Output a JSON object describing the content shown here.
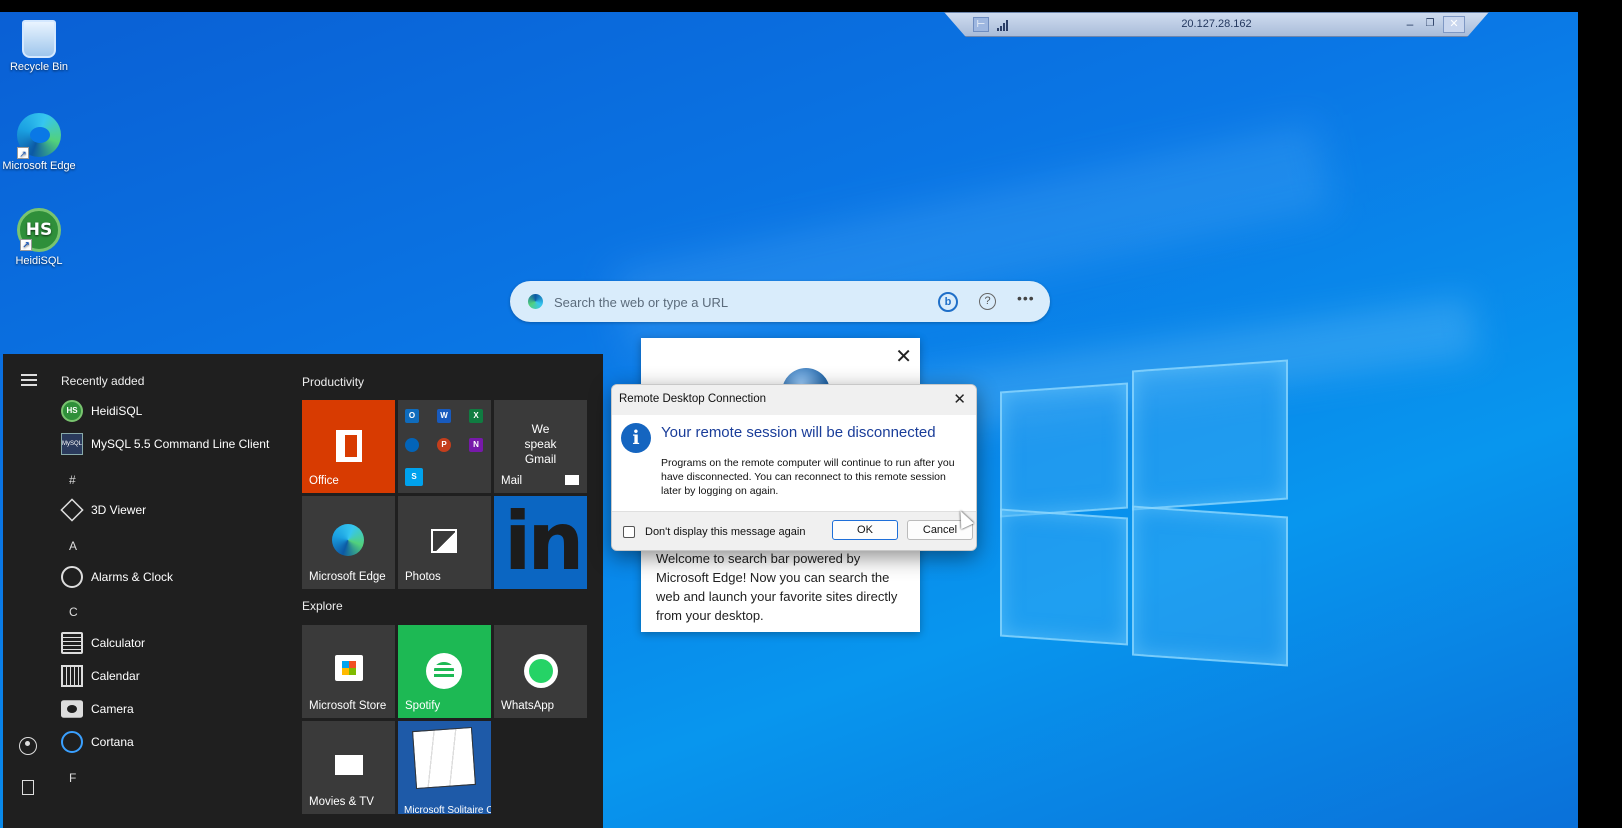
{
  "rdp_bar": {
    "ip": "20.127.28.162",
    "pin_icon": "pin-icon",
    "signal_icon": "signal-bars-icon",
    "minimize_icon": "minimize-icon",
    "restore_icon": "restore-icon",
    "close_icon": "close-icon"
  },
  "desktop": {
    "icons": [
      {
        "label": "Recycle Bin",
        "icon": "recycle-bin-icon"
      },
      {
        "label": "Microsoft Edge",
        "icon": "edge-icon"
      },
      {
        "label": "HeidiSQL",
        "icon": "heidisql-icon"
      }
    ]
  },
  "search_bar": {
    "placeholder": "Search the web or type a URL",
    "bing_glyph": "b",
    "help_glyph": "?",
    "more_glyph": "•••"
  },
  "welcome_popup": {
    "text": "Welcome to search bar powered by Microsoft Edge! Now you can search the web and launch your favorite sites directly from your desktop.",
    "close_glyph": "✕"
  },
  "start_menu": {
    "recently_added_header": "Recently added",
    "recent_apps": [
      {
        "label": "HeidiSQL",
        "icon_text": "HS"
      },
      {
        "label": "MySQL 5.5 Command Line Client",
        "icon_text": "MySQL"
      }
    ],
    "sections": [
      {
        "letter": "#",
        "apps": [
          {
            "label": "3D Viewer"
          }
        ]
      },
      {
        "letter": "A",
        "apps": [
          {
            "label": "Alarms & Clock"
          }
        ]
      },
      {
        "letter": "C",
        "apps": [
          {
            "label": "Calculator"
          },
          {
            "label": "Calendar"
          },
          {
            "label": "Camera"
          },
          {
            "label": "Cortana"
          }
        ]
      },
      {
        "letter": "F",
        "apps": []
      }
    ],
    "productivity_title": "Productivity",
    "explore_title": "Explore",
    "tiles": {
      "office": "Office",
      "mail_text": "We speak Gmail",
      "mail": "Mail",
      "edge": "Microsoft Edge",
      "photos": "Photos",
      "linkedin_glyph": "in",
      "store": "Microsoft Store",
      "spotify": "Spotify",
      "whatsapp": "WhatsApp",
      "movies": "Movies & TV",
      "solitaire": "Microsoft Solitaire Collection"
    },
    "mini_apps": [
      "O",
      "W",
      "X",
      "",
      "P",
      "N",
      "S"
    ]
  },
  "dialog": {
    "title": "Remote Desktop Connection",
    "close_glyph": "✕",
    "info_glyph": "i",
    "heading": "Your remote session will be disconnected",
    "message": "Programs on the remote computer will continue to run after you have disconnected. You can reconnect to this remote session later by logging on again.",
    "checkbox_label": "Don't display this message again",
    "checkbox_checked": false,
    "ok_label": "OK",
    "cancel_label": "Cancel",
    "accent_color": "#1a3d99"
  }
}
